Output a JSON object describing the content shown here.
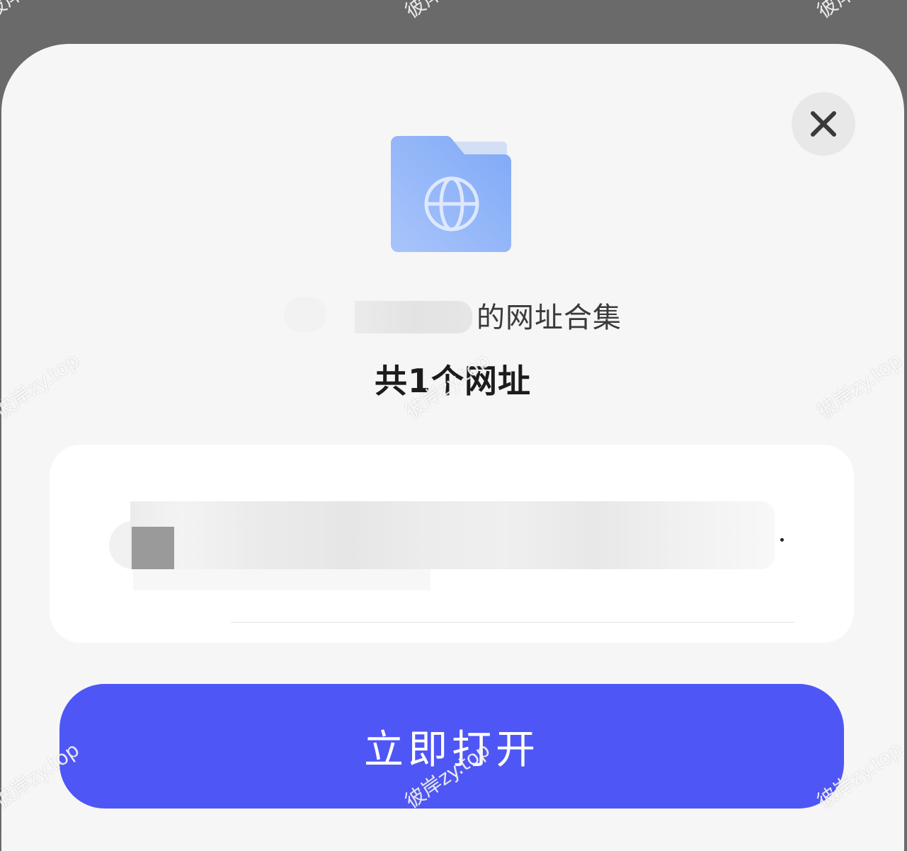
{
  "close_button": {
    "icon": "close-icon"
  },
  "header": {
    "icon": "folder-globe-icon",
    "owner_suffix": "的网址合集",
    "count_title": "共1个网址"
  },
  "url_list": {
    "items": [
      {
        "favicon": "site-favicon"
      }
    ]
  },
  "primary_action": {
    "label": "立即打开"
  },
  "watermark": {
    "text": "彼岸zy.top"
  },
  "colors": {
    "backdrop": "#6a6a6a",
    "sheet": "#f6f6f6",
    "card": "#ffffff",
    "primary": "#4f56f6",
    "folder_light": "#a9c4fb",
    "folder_dark": "#86aff7"
  }
}
